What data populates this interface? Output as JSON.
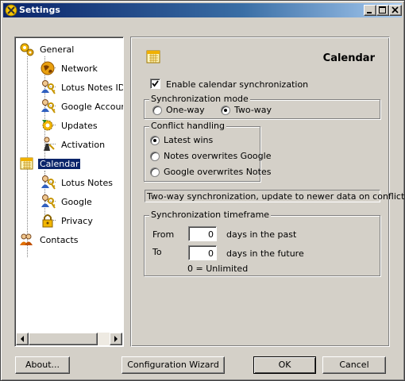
{
  "window": {
    "title": "Settings"
  },
  "tree": {
    "items": [
      {
        "label": "General",
        "icon": "gears-icon"
      },
      {
        "label": "Network",
        "icon": "globe-icon"
      },
      {
        "label": "Lotus Notes ID",
        "icon": "key-user-icon"
      },
      {
        "label": "Google Account",
        "icon": "key-user-icon"
      },
      {
        "label": "Updates",
        "icon": "gear-arrow-icon"
      },
      {
        "label": "Activation",
        "icon": "person-key-icon"
      },
      {
        "label": "Calendar",
        "icon": "calendar-icon",
        "selected": true
      },
      {
        "label": "Lotus Notes",
        "icon": "key-user-icon"
      },
      {
        "label": "Google",
        "icon": "key-user-icon"
      },
      {
        "label": "Privacy",
        "icon": "padlock-icon"
      },
      {
        "label": "Contacts",
        "icon": "people-icon"
      }
    ]
  },
  "panel": {
    "title": "Calendar",
    "enable_sync_label": "Enable calendar synchronization",
    "enable_sync_checked": true,
    "sync_mode": {
      "label": "Synchronization mode",
      "options": [
        "One-way",
        "Two-way"
      ],
      "selected": "Two-way"
    },
    "conflict": {
      "label": "Conflict handling",
      "options": [
        "Latest wins",
        "Notes overwrites Google",
        "Google overwrites Notes"
      ],
      "selected": "Latest wins"
    },
    "status": "Two-way synchronization, update to newer data on conflict",
    "timeframe": {
      "label": "Synchronization timeframe",
      "from_label": "From",
      "from_value": "0",
      "from_suffix": "days in the past",
      "to_label": "To",
      "to_value": "0",
      "to_suffix": "days in the future",
      "note": "0 = Unlimited"
    }
  },
  "buttons": {
    "about": "About...",
    "wizard": "Configuration Wizard",
    "ok": "OK",
    "cancel": "Cancel"
  }
}
